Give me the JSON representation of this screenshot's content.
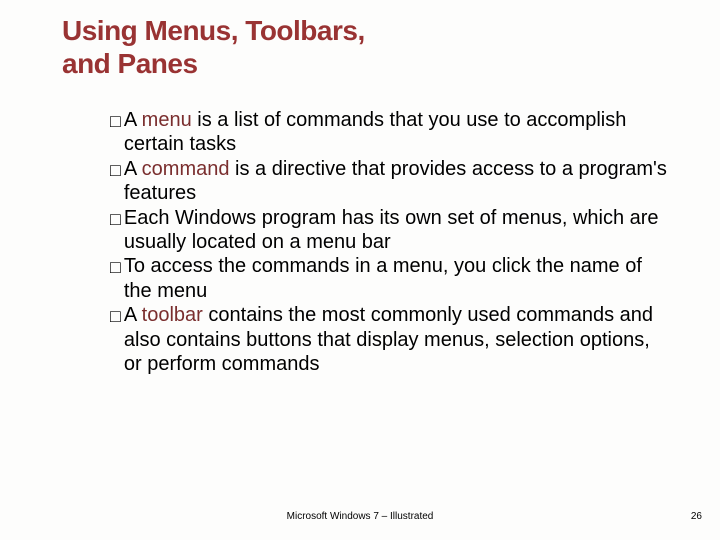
{
  "title_line1": "Using Menus, Toolbars,",
  "title_line2": "and Panes",
  "bullets": {
    "b0": {
      "pre": "A ",
      "kw": "menu",
      "post": " is a list of commands that you use to accomplish certain tasks"
    },
    "b1": {
      "pre": "A ",
      "kw": "command",
      "post": " is a directive that provides access to a program's features"
    },
    "b2": {
      "pre": "",
      "kw": "",
      "post": "Each Windows program has its own set of menus, which are usually located on a menu bar"
    },
    "b3": {
      "pre": "",
      "kw": "",
      "post": "To access the commands in a menu, you click the name of the menu"
    },
    "b4": {
      "pre": "A ",
      "kw": "toolbar",
      "post": " contains the most commonly used commands and also contains buttons that display menus, selection options, or perform commands"
    }
  },
  "footer_text": "Microsoft Windows 7 – Illustrated",
  "page_number": "26",
  "marker": "□ "
}
